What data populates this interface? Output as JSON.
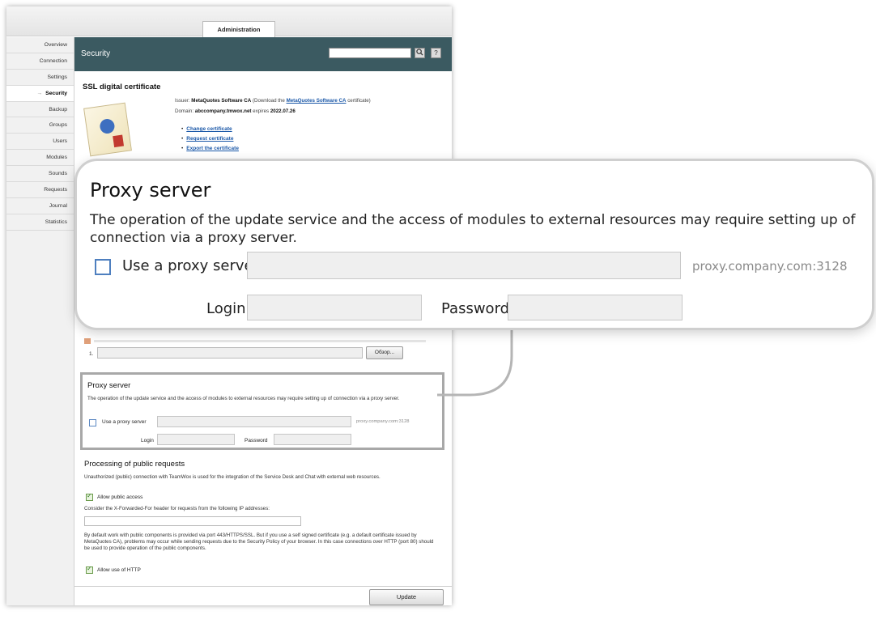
{
  "top_tab": "Administration",
  "sidebar": {
    "items": [
      {
        "label": "Overview"
      },
      {
        "label": "Connection"
      },
      {
        "label": "Settings"
      },
      {
        "label": "Security",
        "active": true
      },
      {
        "label": "Backup"
      },
      {
        "label": "Groups"
      },
      {
        "label": "Users"
      },
      {
        "label": "Modules"
      },
      {
        "label": "Sounds"
      },
      {
        "label": "Requests"
      },
      {
        "label": "Journal"
      },
      {
        "label": "Statistics"
      }
    ]
  },
  "header": {
    "title": "Security",
    "search_icon": "search-icon",
    "help_label": "?"
  },
  "ssl": {
    "title": "SSL digital certificate",
    "issuer_prefix": "Issuer: ",
    "issuer_name": "MetaQuotes Software CA",
    "issuer_mid": " (Download the ",
    "issuer_link": "MetaQuotes Software CA",
    "issuer_suffix": " certificate)",
    "domain_prefix": "Domain: ",
    "domain_name": "abccompany.tmwox.net",
    "domain_mid": " expires ",
    "domain_expires": "2022.07.26",
    "links": [
      "Change certificate",
      "Request certificate",
      "Export the certificate"
    ]
  },
  "file_row": {
    "number": "1.",
    "browse_label": "Обзор..."
  },
  "proxy": {
    "title": "Proxy server",
    "description": "The operation of the update service and the access of modules to external resources may require setting up of connection via a proxy server.",
    "use_label": "Use a proxy server",
    "use_checked": false,
    "proxy_value": "",
    "proxy_hint": "proxy.company.com:3128",
    "login_label": "Login",
    "login_value": "",
    "password_label": "Password",
    "password_value": ""
  },
  "public_requests": {
    "title": "Processing of public requests",
    "description": "Unauthorized (public) connection with TeamWox is used for the integration of the Service Desk and Chat with external web resources.",
    "allow_public_label": "Allow public access",
    "allow_public_checked": true,
    "xff_label": "Consider the X-Forwarded-For header for requests from the following IP addresses:",
    "xff_value": "",
    "https_note": "By default work with public components is provided via port 443/HTTPS/SSL. But if you use a self signed certificate (e.g. a default certificate issued by MetaQuotes CA), problems may occur while sending requests due to the Security Policy of your browser. In this case connections over HTTP (port 80) should be used to provide operation of the public components.",
    "allow_http_label": "Allow use of HTTP",
    "allow_http_checked": true
  },
  "update_label": "Update",
  "colors": {
    "header_bg": "#3b5a61",
    "link": "#1b58a8",
    "callout_border": "#cfcfcf"
  }
}
